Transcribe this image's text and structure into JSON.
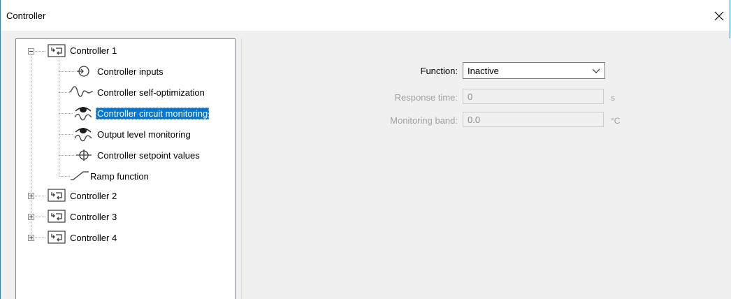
{
  "window": {
    "title": "Controller"
  },
  "tree": {
    "controller1": {
      "label": "Controller 1"
    },
    "children": [
      {
        "label": "Controller inputs",
        "icon": "controller-inputs-icon"
      },
      {
        "label": "Controller self-optimization",
        "icon": "self-optimization-icon"
      },
      {
        "label": "Controller circuit monitoring",
        "icon": "circuit-monitoring-icon",
        "selected": true
      },
      {
        "label": "Output level monitoring",
        "icon": "output-level-monitoring-icon"
      },
      {
        "label": "Controller setpoint values",
        "icon": "setpoint-values-icon"
      },
      {
        "label": "Ramp function",
        "icon": "ramp-function-icon"
      }
    ],
    "controller2": {
      "label": "Controller 2"
    },
    "controller3": {
      "label": "Controller 3"
    },
    "controller4": {
      "label": "Controller 4"
    }
  },
  "form": {
    "function_label": "Function:",
    "function_value": "Inactive",
    "response_time_label": "Response time:",
    "response_time_value": "0",
    "response_time_unit": "s",
    "monitoring_band_label": "Monitoring band:",
    "monitoring_band_value": "0.0",
    "monitoring_band_unit": "°C"
  },
  "colors": {
    "selection": "#0078d7",
    "accent_border": "#3c7fb1"
  }
}
